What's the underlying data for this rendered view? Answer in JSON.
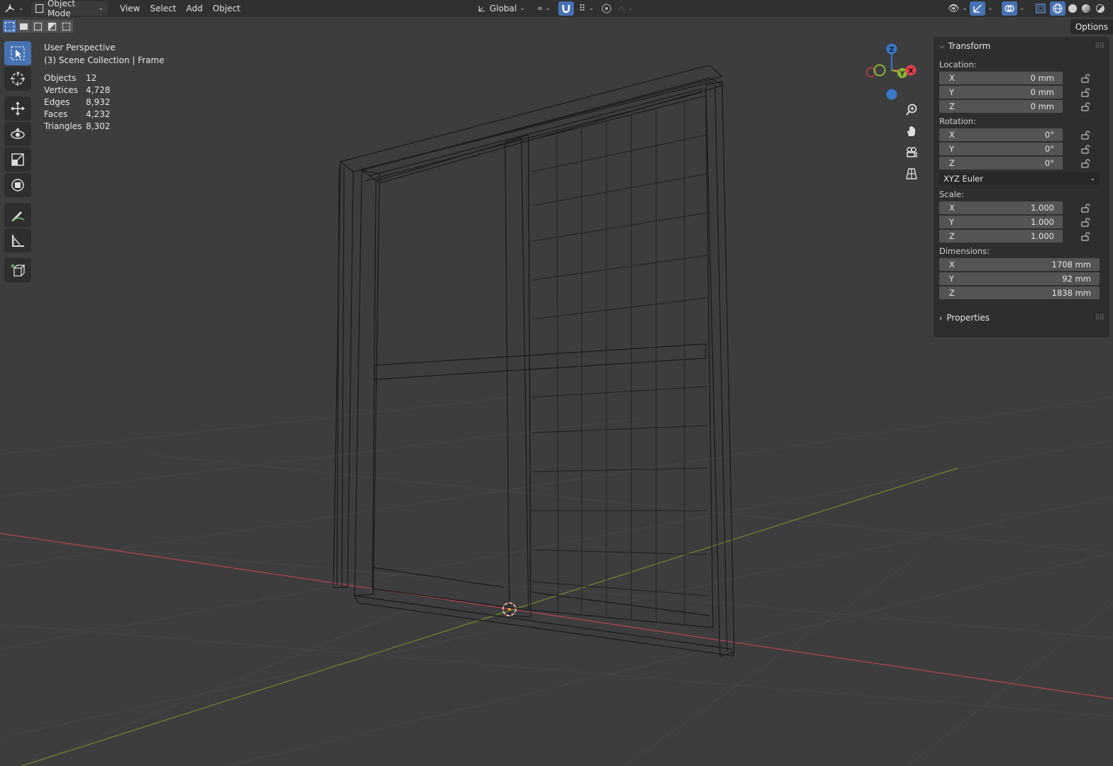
{
  "header": {
    "editor_icon": "viewport-editor-icon",
    "mode": "Object Mode",
    "menus": [
      "View",
      "Select",
      "Add",
      "Object"
    ],
    "transform_orientation": "Global"
  },
  "options_label": "Options",
  "overlay": {
    "view_name": "User Perspective",
    "collection": "(3) Scene Collection | Frame",
    "stats": [
      {
        "label": "Objects",
        "value": "12"
      },
      {
        "label": "Vertices",
        "value": "4,728"
      },
      {
        "label": "Edges",
        "value": "8,932"
      },
      {
        "label": "Faces",
        "value": "4,232"
      },
      {
        "label": "Triangles",
        "value": "8,302"
      }
    ]
  },
  "gizmo": {
    "x": "X",
    "y": "Y",
    "z": "Z"
  },
  "tools": [
    "select-box-icon",
    "cursor-icon",
    "move-icon",
    "rotate-icon",
    "scale-icon",
    "transform-icon",
    "annotate-icon",
    "measure-icon",
    "add-cube-icon"
  ],
  "transform": {
    "title": "Transform",
    "location_label": "Location:",
    "location": [
      {
        "axis": "X",
        "value": "0 mm"
      },
      {
        "axis": "Y",
        "value": "0 mm"
      },
      {
        "axis": "Z",
        "value": "0 mm"
      }
    ],
    "rotation_label": "Rotation:",
    "rotation": [
      {
        "axis": "X",
        "value": "0°"
      },
      {
        "axis": "Y",
        "value": "0°"
      },
      {
        "axis": "Z",
        "value": "0°"
      }
    ],
    "rotation_mode": "XYZ Euler",
    "scale_label": "Scale:",
    "scale": [
      {
        "axis": "X",
        "value": "1.000"
      },
      {
        "axis": "Y",
        "value": "1.000"
      },
      {
        "axis": "Z",
        "value": "1.000"
      }
    ],
    "dimensions_label": "Dimensions:",
    "dimensions": [
      {
        "axis": "X",
        "value": "1708 mm"
      },
      {
        "axis": "Y",
        "value": "92 mm"
      },
      {
        "axis": "Z",
        "value": "1838 mm"
      }
    ]
  },
  "properties_title": "Properties",
  "colors": {
    "accent": "#4772b3",
    "x_axis": "#e0404a",
    "y_axis": "#8cb43a",
    "z_axis": "#3a78c8",
    "background": "#3d3d3d"
  }
}
